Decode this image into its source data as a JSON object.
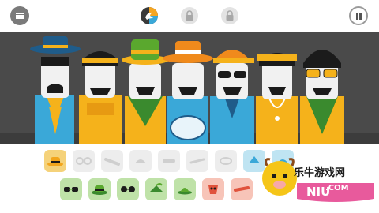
{
  "app": {
    "top_bar": {
      "menu_icon": "hamburger-icon",
      "modes": [
        {
          "icon": "bird-icon",
          "state": "active"
        },
        {
          "icon": "lock-icon",
          "state": "locked"
        },
        {
          "icon": "lock-icon",
          "state": "locked"
        }
      ],
      "pause_icon": "pause-icon"
    },
    "stage": {
      "background": "#4a4a4a",
      "characters": [
        {
          "hat": "blue-fedora",
          "outfit": "blue-yellow-scarf"
        },
        {
          "hat": "yellow-band-cap",
          "outfit": "yellow-shirt"
        },
        {
          "hat": "green-bucket-hat",
          "outfit": "yellow-green-vest"
        },
        {
          "hat": "orange-fedora",
          "outfit": "blue-jacket-drum"
        },
        {
          "hat": "orange-cap",
          "outfit": "blue-jacket",
          "glasses": "sunglasses"
        },
        {
          "hat": "yellow-headband",
          "outfit": "yellow-shirt-chain"
        },
        {
          "hat": "none",
          "outfit": "green-shirt",
          "glasses": "yellow-glasses"
        }
      ]
    },
    "palette": {
      "row1": [
        {
          "icon": "yellow-hat-icon",
          "color": "#f2a51c",
          "state": "available"
        },
        {
          "icon": "glasses-icon",
          "color": "#d8d8d8",
          "state": "empty"
        },
        {
          "icon": "sunglasses-icon",
          "color": "#d8d8d8",
          "state": "empty"
        },
        {
          "icon": "cap-icon",
          "color": "#d8d8d8",
          "state": "empty"
        },
        {
          "icon": "mask-icon",
          "color": "#d8d8d8",
          "state": "empty"
        },
        {
          "icon": "headband-icon",
          "color": "#d8d8d8",
          "state": "empty"
        },
        {
          "icon": "ring-icon",
          "color": "#d8d8d8",
          "state": "empty"
        },
        {
          "icon": "blue-hat-icon",
          "color": "#4cb3d4",
          "state": "available"
        },
        {
          "icon": "blue-cap-icon",
          "color": "#4cb3d4",
          "state": "available"
        }
      ],
      "row2": [
        {
          "icon": "green-glasses-icon",
          "color": "#5aa82e",
          "state": "available"
        },
        {
          "icon": "green-hat-icon",
          "color": "#5aa82e",
          "state": "available"
        },
        {
          "icon": "green-sunglasses-icon",
          "color": "#5aa82e",
          "state": "available"
        },
        {
          "icon": "green-leaf-hat-icon",
          "color": "#5aa82e",
          "state": "available"
        },
        {
          "icon": "green-bowler-icon",
          "color": "#5aa82e",
          "state": "available"
        },
        {
          "icon": "red-mask-icon",
          "color": "#e0523c",
          "state": "available"
        },
        {
          "icon": "red-band-icon",
          "color": "#e0523c",
          "state": "available"
        }
      ]
    },
    "watermark": {
      "text": "乐牛游戏网",
      "domain": ".COM"
    }
  }
}
